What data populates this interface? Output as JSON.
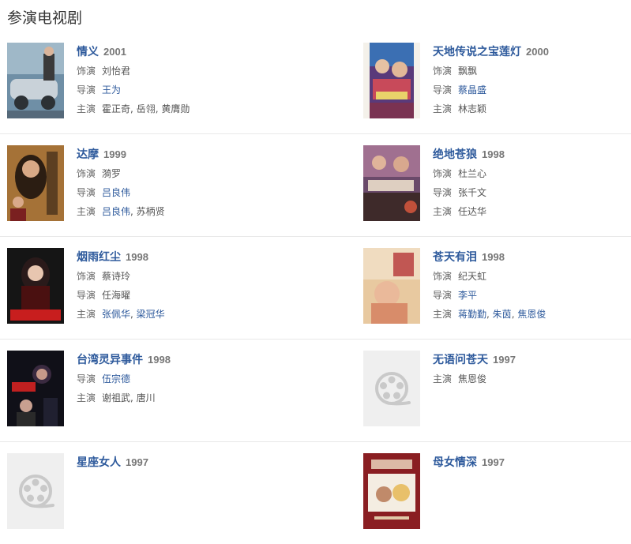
{
  "section_title": "参演电视剧",
  "labels": {
    "role": "饰演",
    "director": "导演",
    "cast": "主演"
  },
  "sep": ", ",
  "colors": {
    "link": "#2e5a9c",
    "year": "#777777",
    "divider": "#e8e8e8",
    "placeholder_bg": "#efefef"
  },
  "items": [
    {
      "title": "情义",
      "year": "2001",
      "role": "刘怡君",
      "director": [
        {
          "name": "王为",
          "link": true
        }
      ],
      "cast": [
        {
          "name": "霍正奇",
          "link": false
        },
        {
          "name": "岳翎",
          "link": false
        },
        {
          "name": "黄膺勋",
          "link": false
        }
      ]
    },
    {
      "title": "天地传说之宝莲灯",
      "year": "2000",
      "role": "飘飘",
      "director": [
        {
          "name": "蔡晶盛",
          "link": true
        }
      ],
      "cast": [
        {
          "name": "林志颖",
          "link": false
        }
      ]
    },
    {
      "title": "达摩",
      "year": "1999",
      "role": "漪罗",
      "director": [
        {
          "name": "吕良伟",
          "link": true
        }
      ],
      "cast": [
        {
          "name": "吕良伟",
          "link": true
        },
        {
          "name": "苏柄贤",
          "link": false
        }
      ]
    },
    {
      "title": "绝地苍狼",
      "year": "1998",
      "role": "杜兰心",
      "director": [
        {
          "name": "张千文",
          "link": false
        }
      ],
      "cast": [
        {
          "name": "任达华",
          "link": false
        }
      ]
    },
    {
      "title": "烟雨红尘",
      "year": "1998",
      "role": "蔡诗玲",
      "director": [
        {
          "name": "任海曜",
          "link": false
        }
      ],
      "cast": [
        {
          "name": "张佩华",
          "link": true
        },
        {
          "name": "梁冠华",
          "link": true
        }
      ]
    },
    {
      "title": "苍天有泪",
      "year": "1998",
      "role": "纪天虹",
      "director": [
        {
          "name": "李平",
          "link": true
        }
      ],
      "cast": [
        {
          "name": "蒋勤勤",
          "link": true
        },
        {
          "name": "朱茵",
          "link": true
        },
        {
          "name": "焦恩俊",
          "link": true
        }
      ]
    },
    {
      "title": "台湾灵异事件",
      "year": "1998",
      "role": null,
      "director": [
        {
          "name": "伍宗德",
          "link": true
        }
      ],
      "cast": [
        {
          "name": "谢祖武",
          "link": false
        },
        {
          "name": "唐川",
          "link": false
        }
      ]
    },
    {
      "title": "无语问苍天",
      "year": "1997",
      "role": null,
      "director": null,
      "cast": [
        {
          "name": "焦恩俊",
          "link": false
        }
      ]
    },
    {
      "title": "星座女人",
      "year": "1997",
      "role": null,
      "director": null,
      "cast": null
    },
    {
      "title": "母女情深",
      "year": "1997",
      "role": null,
      "director": null,
      "cast": null
    }
  ]
}
